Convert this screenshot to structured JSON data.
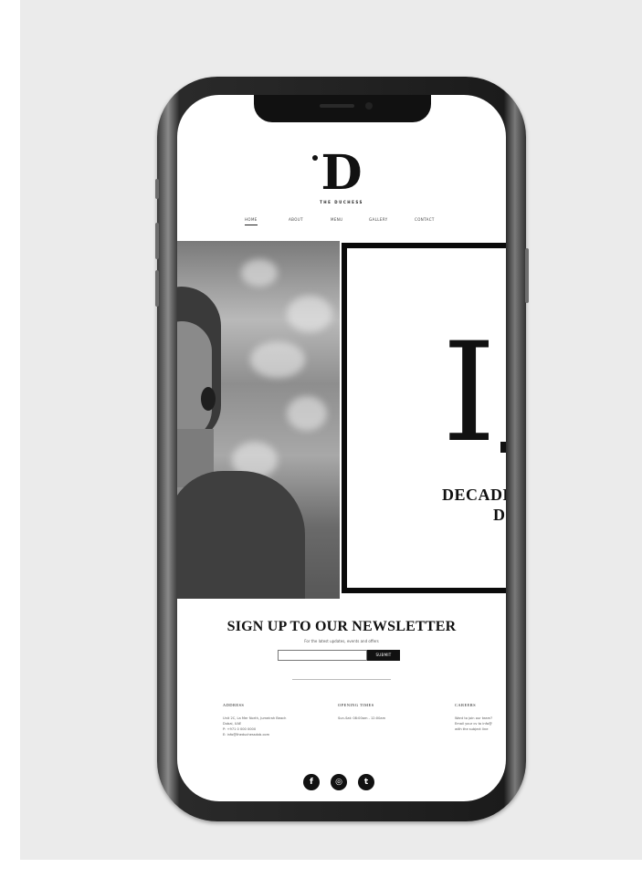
{
  "brand": {
    "logo_letter": "D",
    "logo_text": "THE DUCHESS"
  },
  "nav": {
    "items": [
      "HOME",
      "ABOUT",
      "MENU",
      "GALLERY",
      "CONTACT"
    ],
    "active": "HOME"
  },
  "hero": {
    "big_letter": "I",
    "line1": "DECADE",
    "line2": "D"
  },
  "newsletter": {
    "title": "SIGN UP TO OUR NEWSLETTER",
    "subtitle": "For the latest updates, events and offers",
    "input_placeholder": "",
    "submit_label": "SUBMIT"
  },
  "footer": {
    "address": {
      "heading": "ADDRESS",
      "lines": [
        "Unit 2C, La Mer North, Jumeirah Beach",
        "Dubai, UAE",
        "P: +971 0 000 0000",
        "E: info@theduchessdxb.com"
      ]
    },
    "opening": {
      "heading": "OPENING TIMES",
      "lines": [
        "Sun-Sat: 08:00am - 12:00am"
      ]
    },
    "careers": {
      "heading": "CAREERS",
      "lines": [
        "Want to join our team?",
        "Email your cv to info@",
        "with the subject line"
      ]
    }
  },
  "social": {
    "icons": [
      "facebook-icon",
      "instagram-icon",
      "twitter-icon"
    ],
    "glyphs": [
      "f",
      "◎",
      "t"
    ]
  },
  "colors": {
    "backdrop": "#ebebeb",
    "ink": "#111111",
    "screen": "#ffffff"
  }
}
